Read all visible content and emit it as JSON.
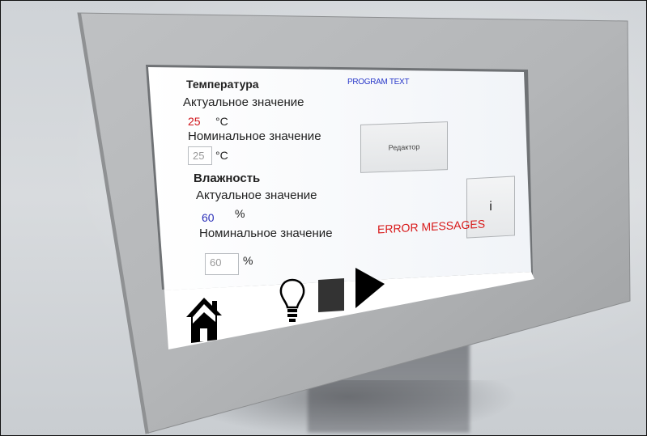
{
  "temperature": {
    "heading": "Температура",
    "actual_label": "Актуальное значение",
    "actual_value": "25",
    "actual_unit": "°C",
    "nominal_label": "Номинальное значение",
    "nominal_value": "25",
    "nominal_unit": "°C"
  },
  "humidity": {
    "heading": "Влажность",
    "actual_label": "Актуальное значение",
    "actual_value": "60",
    "actual_unit": "%",
    "nominal_label": "Номинальное значение",
    "nominal_value": "60",
    "nominal_unit": "%"
  },
  "program_text": "PROGRAM TEXT",
  "editor_button_label": "Редактор",
  "info_button_label": "i",
  "error_messages": "ERROR MESSAGES",
  "toolbar": {
    "icons": [
      "home-icon",
      "lightbulb-icon",
      "stop-icon",
      "play-icon"
    ]
  },
  "colors": {
    "actual_temp": "#d0141a",
    "actual_humidity": "#2a2fb8",
    "program_text": "#2a39c9",
    "error": "#d81a1a"
  }
}
